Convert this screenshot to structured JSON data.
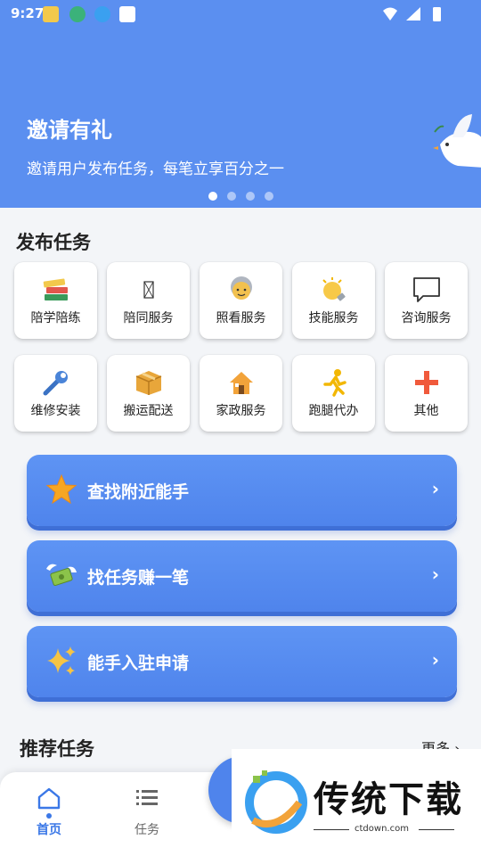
{
  "status_bar": {
    "time": "9:27"
  },
  "banner": {
    "title": "邀请有礼",
    "subtitle": "邀请用户发布任务，每笔立享百分之一",
    "dots": 4,
    "active_dot": 0
  },
  "publish": {
    "title": "发布任务",
    "items": [
      {
        "label": "陪学陪练",
        "icon": "books-icon"
      },
      {
        "label": "陪同服务",
        "icon": "placeholder-glyph-icon"
      },
      {
        "label": "照看服务",
        "icon": "elder-icon"
      },
      {
        "label": "技能服务",
        "icon": "lightbulb-icon"
      },
      {
        "label": "咨询服务",
        "icon": "chat-bubble-icon"
      },
      {
        "label": "维修安装",
        "icon": "wrench-icon"
      },
      {
        "label": "搬运配送",
        "icon": "package-icon"
      },
      {
        "label": "家政服务",
        "icon": "house-icon"
      },
      {
        "label": "跑腿代办",
        "icon": "runner-icon"
      },
      {
        "label": "其他",
        "icon": "plus-icon"
      }
    ]
  },
  "actions": [
    {
      "label": "查找附近能手",
      "icon": "star-icon",
      "chevron": "›"
    },
    {
      "label": "找任务赚一笔",
      "icon": "flying-money-icon",
      "chevron": "›"
    },
    {
      "label": "能手入驻申请",
      "icon": "sparkles-icon",
      "chevron": "›"
    }
  ],
  "recommend": {
    "title": "推荐任务",
    "more": "更多 ›"
  },
  "bottom_nav": {
    "items": [
      {
        "label": "首页",
        "icon": "home-icon",
        "active": true
      },
      {
        "label": "任务",
        "icon": "list-icon",
        "active": false
      }
    ]
  },
  "watermark": {
    "text": "传统下载",
    "url": "ctdown.com"
  },
  "colors": {
    "primary": "#5b8ff0",
    "active_nav": "#3b78e7",
    "inactive_nav": "#666666"
  }
}
